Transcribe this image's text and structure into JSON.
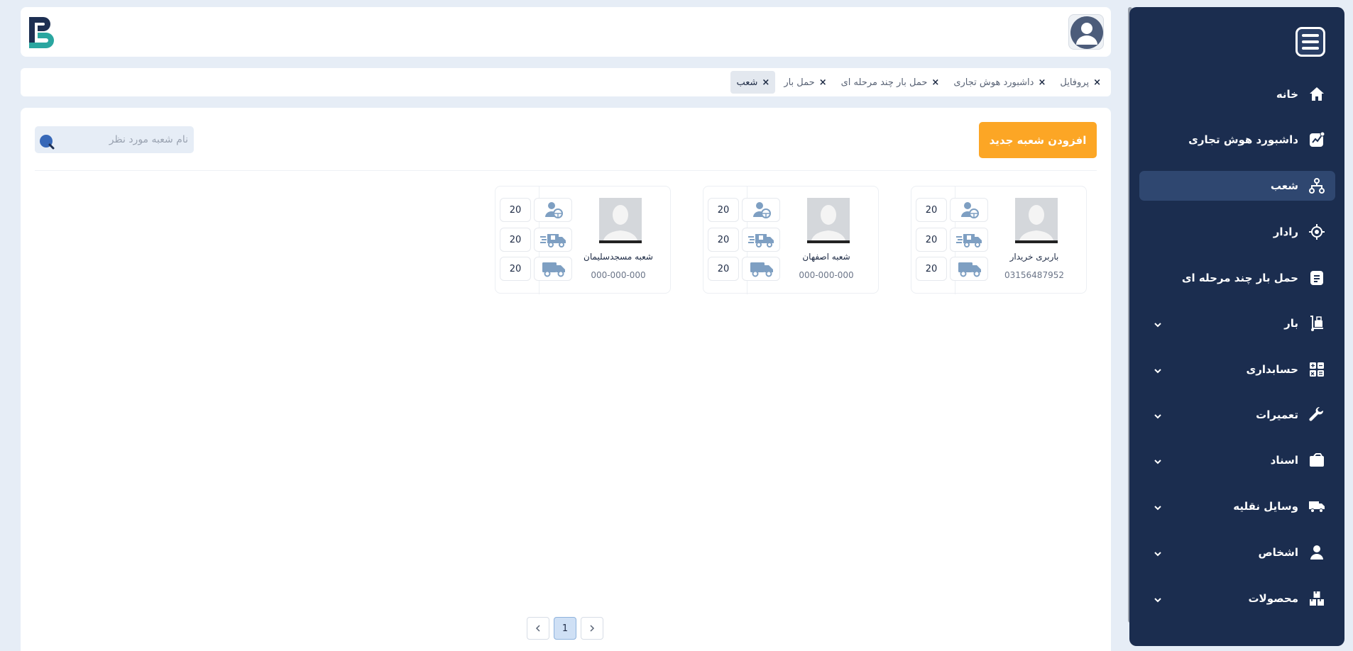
{
  "header": {
    "avatar": "user-avatar",
    "logo": "brand-logo"
  },
  "tabs": [
    {
      "label": "پروفایل",
      "close": "×",
      "active": false
    },
    {
      "label": "داشبورد هوش تجاری",
      "close": "×",
      "active": false
    },
    {
      "label": "حمل بار چند مرحله ای",
      "close": "×",
      "active": false
    },
    {
      "label": "حمل بار",
      "close": "×",
      "active": false
    },
    {
      "label": "شعب",
      "close": "×",
      "active": true
    }
  ],
  "toolbar": {
    "add_branch_label": "افزودن شعبه جدید",
    "search_placeholder": "نام شعبه مورد نظر",
    "search_value": ""
  },
  "branches": [
    {
      "name": "باربری خریدار",
      "phone": "03156487952",
      "drivers": "20",
      "fast_delivery": "20",
      "trucks": "20"
    },
    {
      "name": "شعبه اصفهان",
      "phone": "000-000-000",
      "drivers": "20",
      "fast_delivery": "20",
      "trucks": "20"
    },
    {
      "name": "شعبه مسجدسلیمان",
      "phone": "000-000-000",
      "drivers": "20",
      "fast_delivery": "20",
      "trucks": "20"
    }
  ],
  "pagination": {
    "current": "1",
    "prev": "‹",
    "next": "›"
  },
  "sidebar": {
    "items": [
      {
        "label": "خانه",
        "icon": "home-icon",
        "active": false,
        "expandable": false
      },
      {
        "label": "داشبورد هوش تجاری",
        "icon": "analytics-icon",
        "active": false,
        "expandable": false
      },
      {
        "label": "شعب",
        "icon": "branches-icon",
        "active": true,
        "expandable": false
      },
      {
        "label": "رادار",
        "icon": "radar-icon",
        "active": false,
        "expandable": false
      },
      {
        "label": "حمل بار چند مرحله ای",
        "icon": "document-icon",
        "active": false,
        "expandable": false
      },
      {
        "label": "بار",
        "icon": "cargo-icon",
        "active": false,
        "expandable": true
      },
      {
        "label": "حسابداری",
        "icon": "calculator-icon",
        "active": false,
        "expandable": true
      },
      {
        "label": "تعمیرات",
        "icon": "wrench-icon",
        "active": false,
        "expandable": true
      },
      {
        "label": "اسناد",
        "icon": "folder-icon",
        "active": false,
        "expandable": true
      },
      {
        "label": "وسایل نقلیه",
        "icon": "truck-icon",
        "active": false,
        "expandable": true
      },
      {
        "label": "اشخاص",
        "icon": "person-icon",
        "active": false,
        "expandable": true
      },
      {
        "label": "محصولات",
        "icon": "products-icon",
        "active": false,
        "expandable": true
      }
    ]
  },
  "colors": {
    "sidebar_bg": "#1b2d4f",
    "accent_orange": "#fca625",
    "page_bg": "#e6edf6",
    "icon_blue": "#7e9fc2"
  }
}
